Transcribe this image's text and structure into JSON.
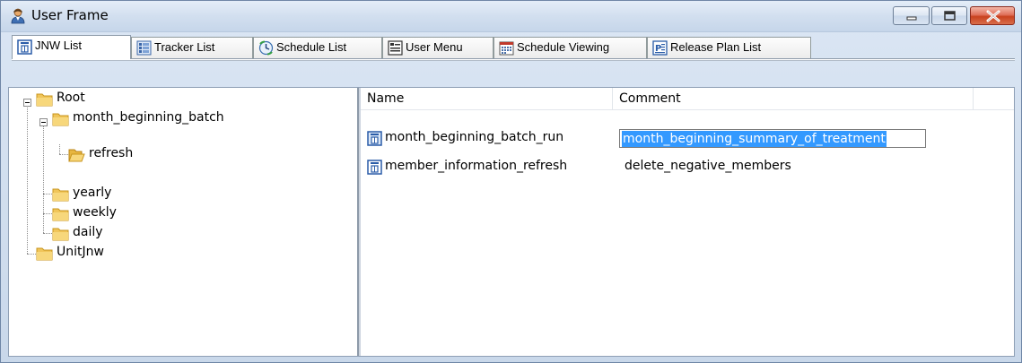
{
  "window": {
    "title": "User Frame",
    "accent": "#3399ff",
    "icon": "user-icon"
  },
  "tabs": [
    {
      "label": "JNW List",
      "icon": "jnw-list-icon",
      "active": true
    },
    {
      "label": "Tracker List",
      "icon": "tracker-list-icon",
      "active": false
    },
    {
      "label": "Schedule List",
      "icon": "schedule-list-icon",
      "active": false
    },
    {
      "label": "User Menu",
      "icon": "user-menu-icon",
      "active": false
    },
    {
      "label": "Schedule Viewing",
      "icon": "calendar-icon",
      "active": false
    },
    {
      "label": "Release Plan List",
      "icon": "release-plan-icon",
      "active": false
    }
  ],
  "tree": {
    "nodes": [
      {
        "label": "Root",
        "expanded": true,
        "level": 0
      },
      {
        "label": "month_beginning_batch",
        "expanded": true,
        "level": 1
      },
      {
        "label": "refresh",
        "level": 2
      },
      {
        "label": "yearly",
        "level": 1
      },
      {
        "label": "weekly",
        "level": 1
      },
      {
        "label": "daily",
        "level": 1
      },
      {
        "label": "UnitJnw",
        "level": 0
      }
    ]
  },
  "list": {
    "columns": [
      "Name",
      "Comment"
    ],
    "rows": [
      {
        "name": "month_beginning_batch_run",
        "comment": "month_beginning_summary_of_treatment",
        "editing": true
      },
      {
        "name": "member_information_refresh",
        "comment": "delete_negative_members",
        "editing": false
      }
    ]
  }
}
